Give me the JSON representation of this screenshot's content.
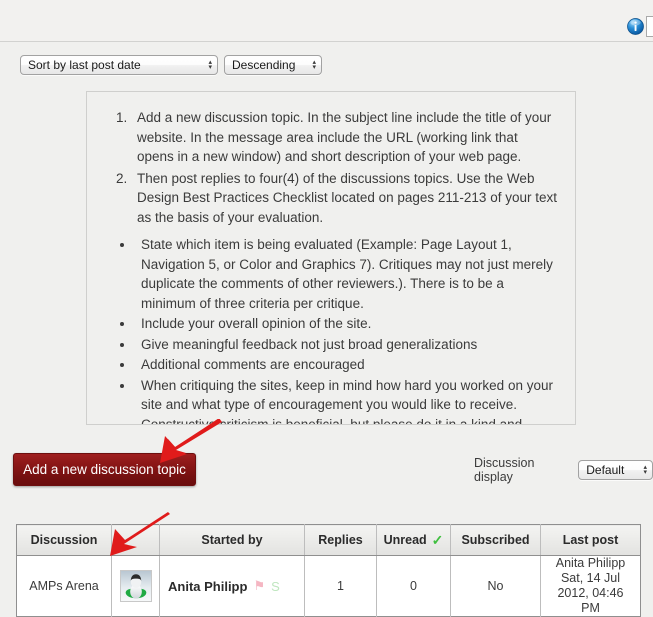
{
  "header": {
    "info_icon": "info-icon"
  },
  "sort_bar": {
    "sort_by": "Sort by last post date",
    "order": "Descending",
    "updown_glyph_up": "▴",
    "updown_glyph_down": "▾"
  },
  "instructions": {
    "numbered": [
      "Add a new discussion topic. In the subject line include the title of your website. In the message area include the URL (working link that opens in a new window) and short description of your web page.",
      "Then post replies to four(4) of the discussions topics.  Use the Web Design Best Practices Checklist located on pages 211-213 of your text as the basis of your evaluation."
    ],
    "bullets": [
      "State which item is being evaluated (Example: Page Layout 1, Navigation 5, or Color and Graphics 7). Critiques may not just merely duplicate the comments of other reviewers.). There is to be a minimum of three criteria per critique.",
      "Include your overall opinion of the site.",
      "Give meaningful feedback not just broad generalizations",
      "Additional comments are encouraged",
      "When critiquing the sites, keep in mind how hard you worked on your site and what type of encouragement you would like to receive. Constructive criticism is beneficial, but please do it in a kind and helpful manner."
    ]
  },
  "actions": {
    "add_topic_label": "Add a new discussion topic",
    "discussion_display_label": "Discussion display",
    "discussion_display_value": "Default"
  },
  "table": {
    "columns": [
      "Discussion",
      "",
      "Started by",
      "Replies",
      "Unread",
      "Subscribed",
      "Last post"
    ],
    "unread_check_glyph": "✓",
    "rows": [
      {
        "discussion": "AMPs Arena",
        "avatar": "user-avatar",
        "started_by": "Anita Philipp",
        "flag_glyph": "⚑",
        "subscribe_glyph": "S",
        "replies": "1",
        "unread": "0",
        "subscribed": "No",
        "last_post_author": "Anita Philipp",
        "last_post_date": "Sat, 14 Jul 2012, 04:46 PM"
      }
    ]
  },
  "annotations": {
    "arrow_color": "#e01b1b",
    "arrow_add_topic": "arrow-pointing-to-add-topic-button",
    "arrow_discussion_column": "arrow-pointing-to-discussion-column"
  }
}
